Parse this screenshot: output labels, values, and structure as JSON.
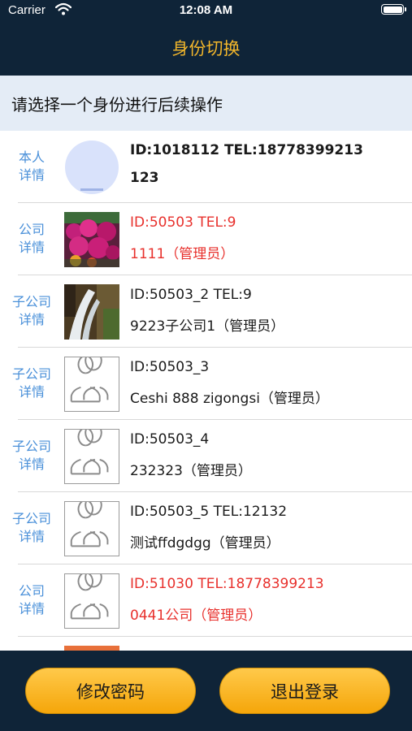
{
  "status_bar": {
    "carrier": "Carrier",
    "time": "12:08 AM"
  },
  "nav": {
    "title": "身份切换"
  },
  "banner": {
    "text": "请选择一个身份进行后续操作"
  },
  "rows": [
    {
      "detail_line1": "本人",
      "detail_line2": "详情",
      "line1": "ID:1018112  TEL:18778399213",
      "line2": "123",
      "thumb": "avatar"
    },
    {
      "detail_line1": "公司",
      "detail_line2": "详情",
      "line1": "ID:50503   TEL:9",
      "line2": "1111（管理员）",
      "thumb": "flowers",
      "highlighted": true
    },
    {
      "detail_line1": "子公司",
      "detail_line2": "详情",
      "line1": "ID:50503_2   TEL:9",
      "line2": "9223子公司1（管理员）",
      "thumb": "waterfall"
    },
    {
      "detail_line1": "子公司",
      "detail_line2": "详情",
      "line1": "ID:50503_3",
      "line2": "Ceshi 888 zigongsi（管理员）",
      "thumb": "users-placeholder"
    },
    {
      "detail_line1": "子公司",
      "detail_line2": "详情",
      "line1": "ID:50503_4",
      "line2": "232323（管理员）",
      "thumb": "users-placeholder"
    },
    {
      "detail_line1": "子公司",
      "detail_line2": "详情",
      "line1": "ID:50503_5   TEL:12132",
      "line2": "测试ffdgdgg（管理员）",
      "thumb": "users-placeholder"
    },
    {
      "detail_line1": "公司",
      "detail_line2": "详情",
      "line1": "ID:51030   TEL:18778399213",
      "line2": "0441公司（管理员）",
      "thumb": "users-placeholder",
      "highlighted": true
    }
  ],
  "buttons": {
    "change_password": "修改密码",
    "logout": "退出登录"
  },
  "colors": {
    "nav_background": "#0f2438",
    "nav_title": "#f2b62b",
    "detail_link": "#4a90d9",
    "highlight_text": "#e8302c",
    "button": "#f5a60a"
  }
}
